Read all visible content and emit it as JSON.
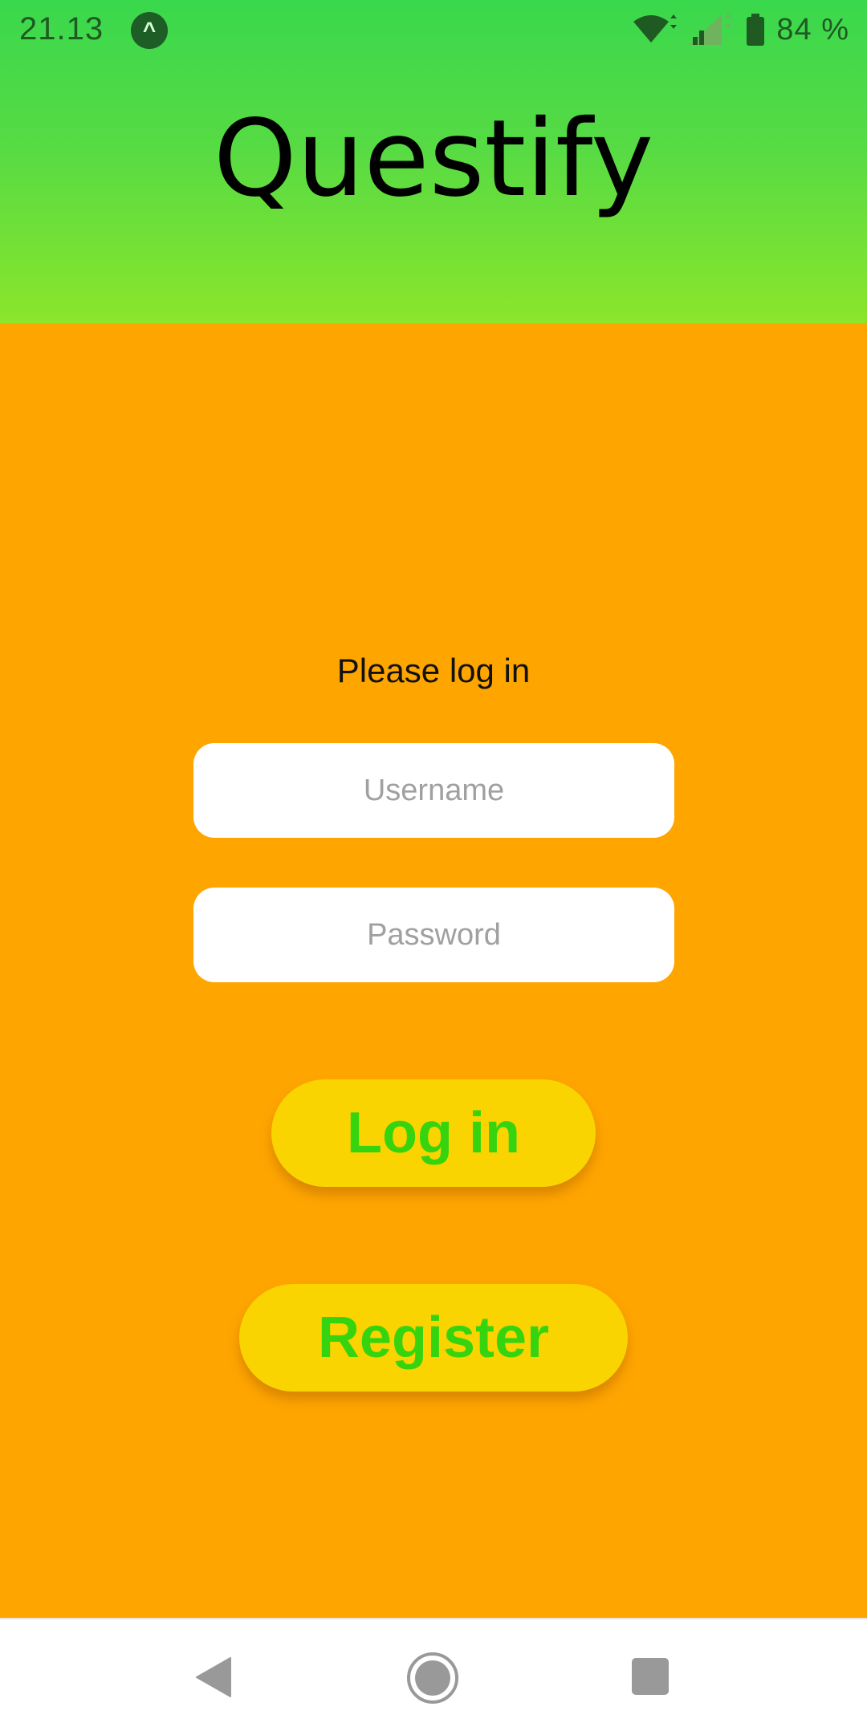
{
  "status_bar": {
    "time": "21.13",
    "app_indicator": "^",
    "battery": "84 %",
    "icons": [
      "wifi-icon",
      "signal-icon",
      "battery-icon"
    ]
  },
  "header": {
    "title": "Questify"
  },
  "login": {
    "prompt": "Please log in",
    "username_placeholder": "Username",
    "password_placeholder": "Password",
    "login_label": "Log in",
    "register_label": "Register"
  },
  "nav": {
    "icons": [
      "back-icon",
      "home-icon",
      "recents-icon"
    ]
  },
  "colors": {
    "header_gradient_top": "#3AD84D",
    "header_gradient_bottom": "#8BE52B",
    "background": "#FFA500",
    "button_bg": "#FAD400",
    "button_text": "#36D40E"
  }
}
